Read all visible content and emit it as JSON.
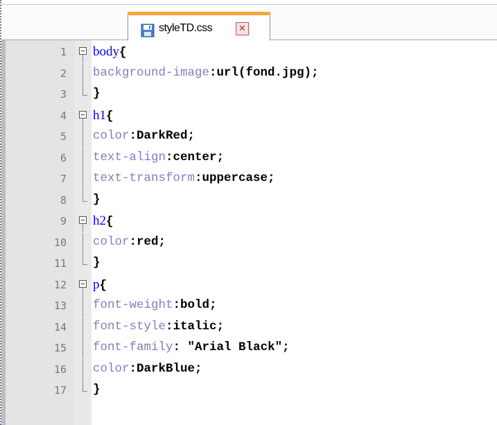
{
  "tab": {
    "label": "styleTD.css",
    "icon": "save-disk-icon",
    "close_glyph": "✕",
    "accent_color": "#f7a53a"
  },
  "lines": [
    {
      "num": "1",
      "selector": "body",
      "open": "{"
    },
    {
      "num": "2",
      "prop": "background-image",
      "value": "url(fond.jpg)"
    },
    {
      "num": "3",
      "close": "}"
    },
    {
      "num": "4",
      "selector": "h1",
      "open": "{"
    },
    {
      "num": "5",
      "prop": "color",
      "value": "DarkRed"
    },
    {
      "num": "6",
      "prop": "text-align",
      "value": "center"
    },
    {
      "num": "7",
      "prop": "text-transform",
      "value": "uppercase"
    },
    {
      "num": "8",
      "close": "}"
    },
    {
      "num": "9",
      "selector": "h2",
      "open": "{"
    },
    {
      "num": "10",
      "prop": "color",
      "value": "red"
    },
    {
      "num": "11",
      "close": "}"
    },
    {
      "num": "12",
      "selector": "p",
      "open": "{"
    },
    {
      "num": "13",
      "prop": "font-weight",
      "value": "bold"
    },
    {
      "num": "14",
      "prop": "font-style",
      "value": "italic"
    },
    {
      "num": "15",
      "prop": "font-family",
      "value": " \"Arial Black\""
    },
    {
      "num": "16",
      "prop": "color",
      "value": "DarkBlue"
    },
    {
      "num": "17",
      "close": "}"
    }
  ],
  "colors": {
    "selector": "#0000ff",
    "property": "#8080c0",
    "value": "#000000",
    "line_number": "#777777"
  }
}
